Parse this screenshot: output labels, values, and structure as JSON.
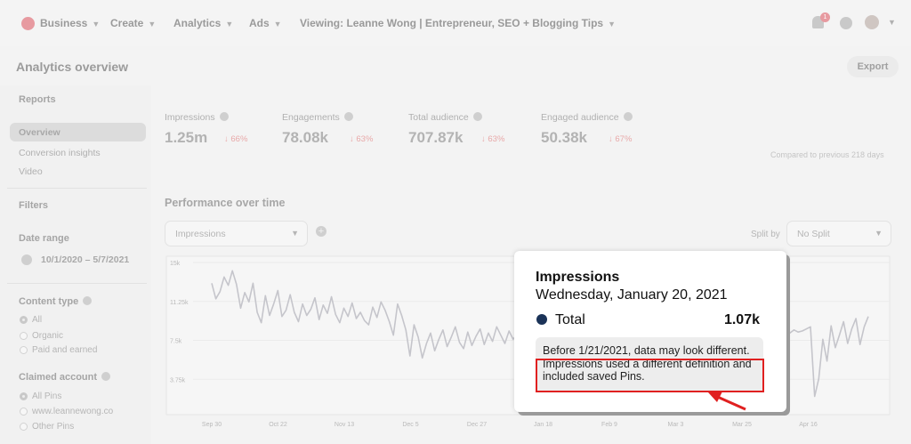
{
  "nav": {
    "business": "Business",
    "create": "Create",
    "analytics": "Analytics",
    "ads": "Ads",
    "viewing": "Viewing: Leanne Wong | Entrepreneur, SEO + Blogging Tips",
    "notification_count": "1"
  },
  "page": {
    "title": "Analytics overview",
    "export": "Export"
  },
  "sidebar": {
    "reports": "Reports",
    "items": [
      "Overview",
      "Conversion insights",
      "Video"
    ],
    "filters": "Filters",
    "date_range_label": "Date range",
    "date_range": "10/1/2020 – 5/7/2021",
    "content_type_label": "Content type",
    "content_type_options": [
      "All",
      "Organic",
      "Paid and earned"
    ],
    "claimed_account_label": "Claimed account",
    "claimed_account_options": [
      "All Pins",
      "www.leannewong.co",
      "Other Pins"
    ]
  },
  "metrics": [
    {
      "label": "Impressions",
      "value": "1.25m",
      "change": "66%"
    },
    {
      "label": "Engagements",
      "value": "78.08k",
      "change": "63%"
    },
    {
      "label": "Total audience",
      "value": "707.87k",
      "change": "63%"
    },
    {
      "label": "Engaged audience",
      "value": "50.38k",
      "change": "67%"
    }
  ],
  "compare_note": "Compared to previous 218 days",
  "performance": {
    "title": "Performance over time",
    "metric_select": "Impressions",
    "split_label": "Split by",
    "split_select": "No Split"
  },
  "chart_data": {
    "type": "line",
    "ylabel": "",
    "yticks": [
      "15k",
      "11.25k",
      "7.5k",
      "3.75k"
    ],
    "ylim": [
      0,
      15000
    ],
    "xticks": [
      "Sep 30",
      "Oct 22",
      "Nov 13",
      "Dec 5",
      "Dec 27",
      "Jan 18",
      "Feb 9",
      "Mar 3",
      "Mar 25",
      "Apr 16"
    ],
    "grid": true,
    "series": [
      {
        "values": [
          13000,
          11500,
          12200,
          13600,
          12800,
          14200,
          12900,
          10600,
          12100,
          11200,
          13000,
          10200,
          9200,
          11800,
          9900,
          11000,
          12300,
          9800,
          10400,
          11900,
          10200,
          9300,
          11000,
          9900,
          10500,
          11600,
          9500,
          10900,
          10100,
          11700,
          10000,
          9200,
          10600,
          9800,
          11100,
          9600,
          10200,
          9400,
          9000,
          10700,
          9700,
          11200,
          10400,
          9300,
          8000,
          11000,
          9900,
          8500,
          6000,
          9000,
          7800,
          5800,
          7200,
          8200,
          6500,
          7600,
          8500,
          6900,
          7800,
          8800,
          7300,
          6700,
          8300,
          7000,
          7900,
          8600,
          7100,
          8200,
          7400,
          8800,
          8000,
          7200,
          8400,
          7600,
          8100,
          9000,
          7700,
          8500,
          7300,
          8900,
          7900,
          8200,
          9100,
          7800,
          8600,
          7500,
          8300,
          9200,
          8000,
          8400,
          7700,
          8600,
          8200,
          7900,
          8400,
          8100,
          8200,
          8300,
          8500,
          8100,
          8400,
          8300,
          8600,
          8200,
          8700,
          8400,
          8300,
          8500,
          8200,
          8600,
          8800,
          8400,
          8500,
          8700,
          8300,
          8600,
          8500,
          8300,
          8600,
          8400,
          8800,
          8500,
          8200,
          8600,
          8300,
          8700,
          8400,
          8600,
          8500,
          8200,
          8400,
          8600,
          8300,
          8500,
          8700,
          8400,
          8300,
          8500,
          8600,
          8400,
          8200,
          8500,
          8300,
          8400,
          8600,
          8800,
          2100,
          3800,
          7600,
          5500,
          8900,
          6800,
          8000,
          9300,
          7200,
          8600,
          9600,
          7100,
          8800,
          9800
        ]
      }
    ]
  },
  "tooltip": {
    "metric": "Impressions",
    "date": "Wednesday, January 20, 2021",
    "series": "Total",
    "value": "1.07k",
    "note": "Before 1/21/2021, data may look different. Impressions used a different definition and included saved Pins."
  },
  "colors": {
    "brand": "#e60023",
    "annotation": "#e02020",
    "series_dot": "#1b3358"
  }
}
